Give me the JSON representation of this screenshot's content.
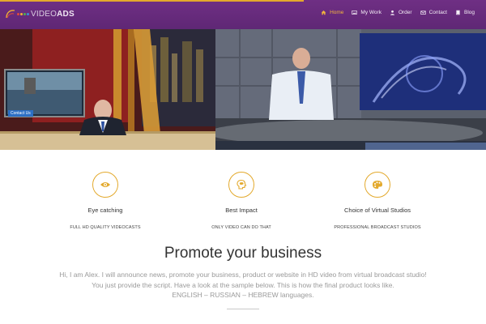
{
  "brand": {
    "logo_text_prefix": "VIDEO",
    "logo_text_suffix": "ADS",
    "dot_colors": [
      "#e24c3a",
      "#f2b134",
      "#4caf50",
      "#3a8fd8"
    ],
    "accent_color": "#e3a92c",
    "topbar_color": "#6a2c80"
  },
  "nav": {
    "items": [
      {
        "label": "Home",
        "icon": "home-icon",
        "active": true
      },
      {
        "label": "My Work",
        "icon": "image-icon",
        "active": false
      },
      {
        "label": "Order",
        "icon": "user-icon",
        "active": false
      },
      {
        "label": "Contact",
        "icon": "envelope-icon",
        "active": false
      },
      {
        "label": "Blog",
        "icon": "book-icon",
        "active": false
      }
    ]
  },
  "hero": {
    "lower_third": "Contact Us"
  },
  "features": [
    {
      "icon": "eye-icon",
      "title": "Eye catching",
      "subtitle": "FULL HD QUALITY VIDEOCASTS"
    },
    {
      "icon": "head-brain-icon",
      "title": "Best Impact",
      "subtitle": "ONLY VIDEO CAN DO THAT"
    },
    {
      "icon": "palette-icon",
      "title": "Choice of Virtual Studios",
      "subtitle": "PROFESSIONAL BROADCAST STUDIOS"
    }
  ],
  "promo": {
    "title": "Promote your business",
    "lines": [
      "Hi, I am Alex. I will announce news, promote your business, product or website in HD video from virtual broadcast studio!",
      "You just provide the script. Have a look at the sample below. This is how the final product looks like.",
      "ENGLISH – RUSSIAN – HEBREW languages."
    ]
  }
}
